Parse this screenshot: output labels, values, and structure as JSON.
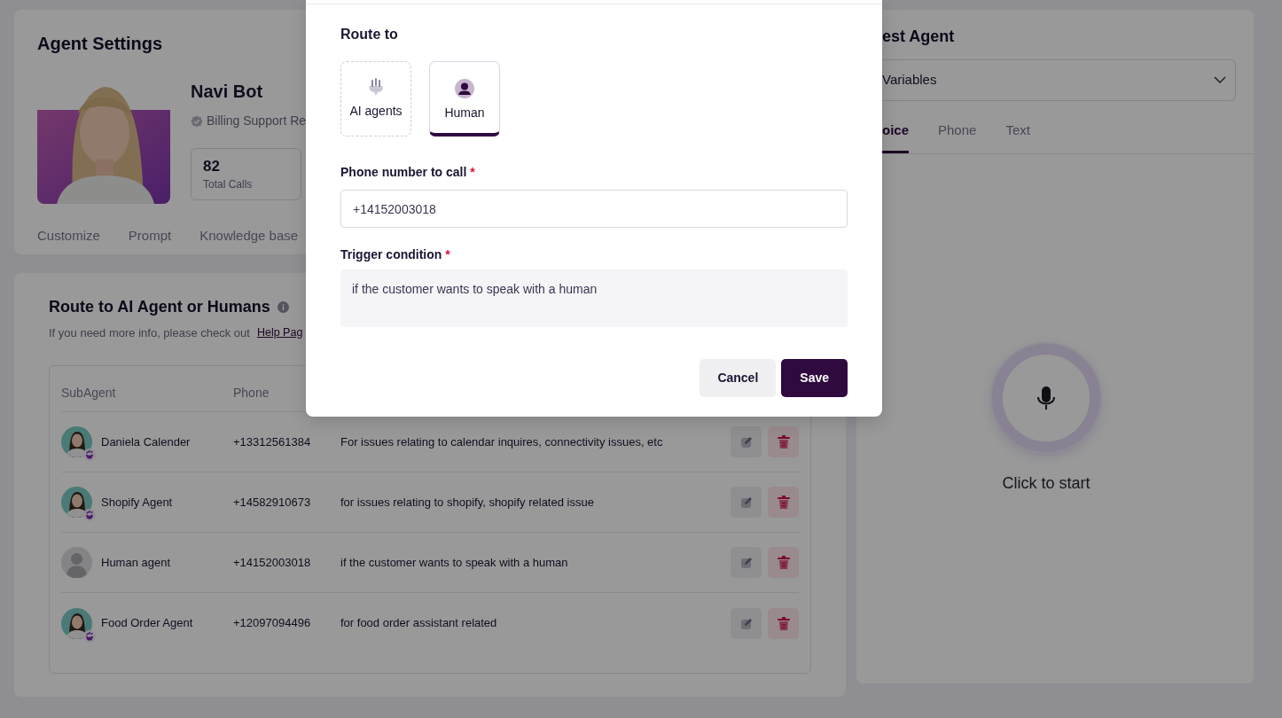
{
  "agent_settings": {
    "title": "Agent Settings",
    "photo": {
      "kind": "picture"
    },
    "name": "Navi Bot",
    "role": "Billing Support Re",
    "verified": true,
    "stats": [
      {
        "value": "82",
        "label": "Total Calls"
      }
    ],
    "tabs": [
      {
        "label": "Customize"
      },
      {
        "label": "Prompt"
      },
      {
        "label": "Knowledge base"
      }
    ]
  },
  "routing": {
    "title": "Route to AI Agent or Humans",
    "info_text": "If you need more info, please check out",
    "link": "Help Pag",
    "table": {
      "columns": [
        "SubAgent",
        "Phone"
      ],
      "rows": [
        {
          "name": "Daniela Calender",
          "phone": "+13312561384",
          "description": "For issues relating to calendar inquires, connectivity issues, etc",
          "avatar": {
            "kind": "picture",
            "badge": true
          }
        },
        {
          "name": "Shopify Agent",
          "phone": "+14582910673",
          "description": "for issues relating to shopify, shopify related issue",
          "avatar": {
            "kind": "picture",
            "badge": true
          }
        },
        {
          "name": "Human agent",
          "phone": "+14152003018",
          "description": "if the customer wants to speak with a human",
          "avatar": {
            "kind": "silhouette",
            "badge": false
          }
        },
        {
          "name": "Food Order Agent",
          "phone": "+12097094496",
          "description": "for food order assistant related",
          "avatar": {
            "kind": "picture",
            "badge": true
          }
        }
      ]
    }
  },
  "test_agent": {
    "title": "est Agent",
    "dropdown": "Variables",
    "tabs": [
      {
        "label": "oice",
        "selected": true
      },
      {
        "label": "Phone",
        "selected": false
      },
      {
        "label": "Text",
        "selected": false
      }
    ],
    "action": "Click to start"
  },
  "modal": {
    "title": "Route to",
    "options": [
      {
        "label": "AI agents",
        "kind": "ai",
        "selected": false
      },
      {
        "label": "Human",
        "kind": "human",
        "selected": true
      }
    ],
    "fields": [
      {
        "label": "Phone number to call",
        "required_mark": "*",
        "kind": "input",
        "value": "+14152003018"
      },
      {
        "label": "Trigger condition",
        "required_mark": "*",
        "kind": "textarea",
        "value": "if the customer wants to speak with a human"
      }
    ],
    "buttons": [
      {
        "label": "Cancel",
        "kind": "secondary"
      },
      {
        "label": "Save",
        "kind": "primary"
      }
    ]
  }
}
